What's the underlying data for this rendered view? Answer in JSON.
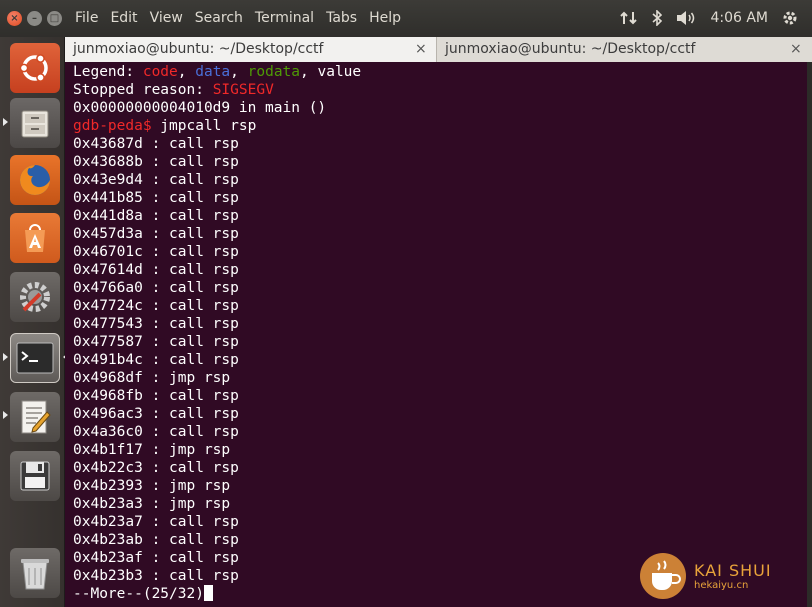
{
  "menubar": {
    "items": [
      "File",
      "Edit",
      "View",
      "Search",
      "Terminal",
      "Tabs",
      "Help"
    ],
    "clock": "4:06 AM"
  },
  "window_buttons": {
    "close": "×",
    "minimize": "–",
    "maximize": "□"
  },
  "tabs": [
    {
      "label": "junmoxiao@ubuntu: ~/Desktop/cctf",
      "active": true
    },
    {
      "label": "junmoxiao@ubuntu: ~/Desktop/cctf",
      "active": false
    }
  ],
  "tab_close": "×",
  "launcher": {
    "items": [
      "ubuntu-dash-icon",
      "files-icon",
      "firefox-icon",
      "software-center-icon",
      "system-settings-icon",
      "terminal-icon",
      "text-editor-icon",
      "save-disk-icon",
      "trash-icon"
    ]
  },
  "terminal": {
    "legend_label": "Legend: ",
    "legend_code": "code",
    "legend_sep1": ", ",
    "legend_data": "data",
    "legend_sep2": ", ",
    "legend_rodata": "rodata",
    "legend_sep3": ", ",
    "legend_value": "value",
    "stopped_label": "Stopped reason: ",
    "stopped_reason": "SIGSEGV",
    "location_line": "0x00000000004010d9 in main ()",
    "prompt": "gdb-peda$",
    "command": " jmpcall rsp",
    "results": [
      "0x43687d : call rsp",
      "0x43688b : call rsp",
      "0x43e9d4 : call rsp",
      "0x441b85 : call rsp",
      "0x441d8a : call rsp",
      "0x457d3a : call rsp",
      "0x46701c : call rsp",
      "0x47614d : call rsp",
      "0x4766a0 : call rsp",
      "0x47724c : call rsp",
      "0x477543 : call rsp",
      "0x477587 : call rsp",
      "0x491b4c : call rsp",
      "0x4968df : jmp rsp",
      "0x4968fb : call rsp",
      "0x496ac3 : call rsp",
      "0x4a36c0 : call rsp",
      "0x4b1f17 : jmp rsp",
      "0x4b22c3 : call rsp",
      "0x4b2393 : jmp rsp",
      "0x4b23a3 : jmp rsp",
      "0x4b23a7 : call rsp",
      "0x4b23ab : call rsp",
      "0x4b23af : call rsp",
      "0x4b23b3 : call rsp"
    ],
    "pager": "--More--(25/32)"
  },
  "watermark": {
    "brand": "KAI SHUI",
    "site": "hekaiyu.cn"
  },
  "colors": {
    "terminal_bg": "#300a24",
    "prompt_red": "#ef2929",
    "data_blue": "#4a6fd8",
    "rodata_green": "#4e9a06"
  }
}
